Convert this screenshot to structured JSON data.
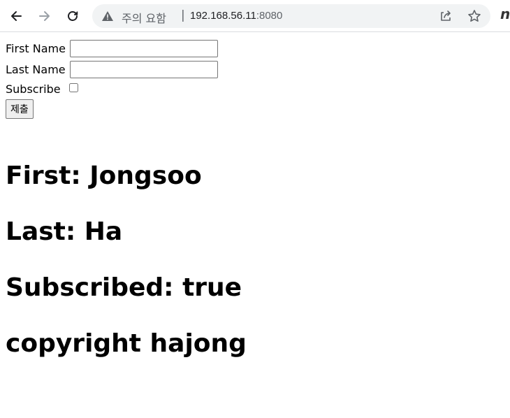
{
  "browser": {
    "security_label": "주의 요함",
    "divider": "|",
    "url_host": "192.168.56.11",
    "url_port": ":8080",
    "profile_glyph": "n"
  },
  "form": {
    "first_name_label": "First Name",
    "first_name_value": "",
    "last_name_label": "Last Name",
    "last_name_value": "",
    "subscribe_label": "Subscribe",
    "subscribe_checked": false,
    "submit_label": "제출"
  },
  "results": {
    "first": "First: Jongsoo",
    "last": "Last: Ha",
    "subscribed": "Subscribed: true",
    "copyright": "copyright hajong"
  },
  "icons": {
    "back": "back-arrow-icon",
    "forward": "forward-arrow-icon",
    "reload": "reload-icon",
    "warning": "warning-icon",
    "share": "share-icon",
    "bookmark": "star-icon"
  },
  "colors": {
    "omnibox_bg": "#f1f3f4",
    "chrome_text": "#5f6368",
    "forward_disabled": "#9aa0a6"
  }
}
